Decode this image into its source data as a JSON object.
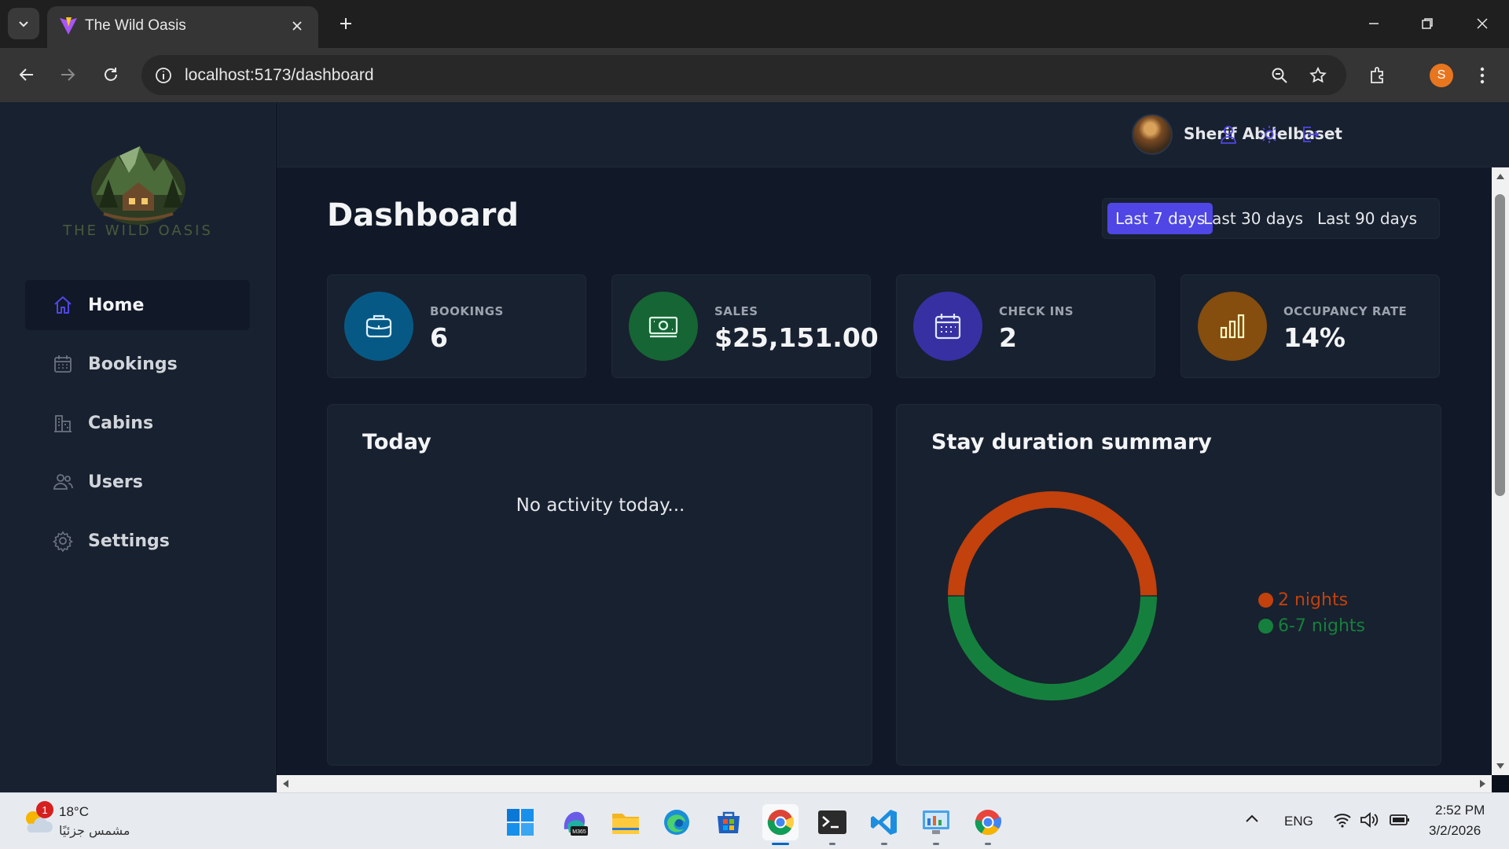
{
  "browser": {
    "tab_title": "The Wild Oasis",
    "url": "localhost:5173/dashboard",
    "profile_initial": "S"
  },
  "sidebar": {
    "logo_text": "THE WILD OASIS",
    "items": [
      {
        "label": "Home",
        "icon": "home-icon",
        "active": true
      },
      {
        "label": "Bookings",
        "icon": "calendar-icon",
        "active": false
      },
      {
        "label": "Cabins",
        "icon": "building-icon",
        "active": false
      },
      {
        "label": "Users",
        "icon": "users-icon",
        "active": false
      },
      {
        "label": "Settings",
        "icon": "gear-icon",
        "active": false
      }
    ]
  },
  "header": {
    "user_name": "Sherif Abdelbaset"
  },
  "dashboard": {
    "title": "Dashboard",
    "filters": [
      {
        "label": "Last 7 days",
        "active": true
      },
      {
        "label": "Last 30 days",
        "active": false
      },
      {
        "label": "Last 90 days",
        "active": false
      }
    ],
    "stats": [
      {
        "label": "BOOKINGS",
        "value": "6",
        "icon": "briefcase-icon",
        "color": "#075985"
      },
      {
        "label": "SALES",
        "value": "$25,151.00",
        "icon": "banknotes-icon",
        "color": "#166534"
      },
      {
        "label": "CHECK INS",
        "value": "2",
        "icon": "calendar-days-icon",
        "color": "#3730a3"
      },
      {
        "label": "OCCUPANCY RATE",
        "value": "14%",
        "icon": "chart-bar-icon",
        "color": "#854d0e"
      }
    ],
    "today": {
      "title": "Today",
      "empty_message": "No activity today..."
    },
    "stay_duration": {
      "title": "Stay duration summary"
    }
  },
  "chart_data": {
    "type": "pie",
    "title": "Stay duration summary",
    "series": [
      {
        "name": "2 nights",
        "value": 1,
        "color": "#c2410c"
      },
      {
        "name": "6-7 nights",
        "value": 1,
        "color": "#15803d"
      }
    ],
    "donut": true,
    "legend": "right"
  },
  "taskbar": {
    "weather_temp": "18°C",
    "weather_desc": "مشمس جزئيًا",
    "weather_badge": "1",
    "language": "ENG",
    "time": "2:52 PM",
    "date": "3/2/2026"
  },
  "colors": {
    "accent": "#4f46e5",
    "background": "#111827",
    "surface": "#18212f"
  }
}
